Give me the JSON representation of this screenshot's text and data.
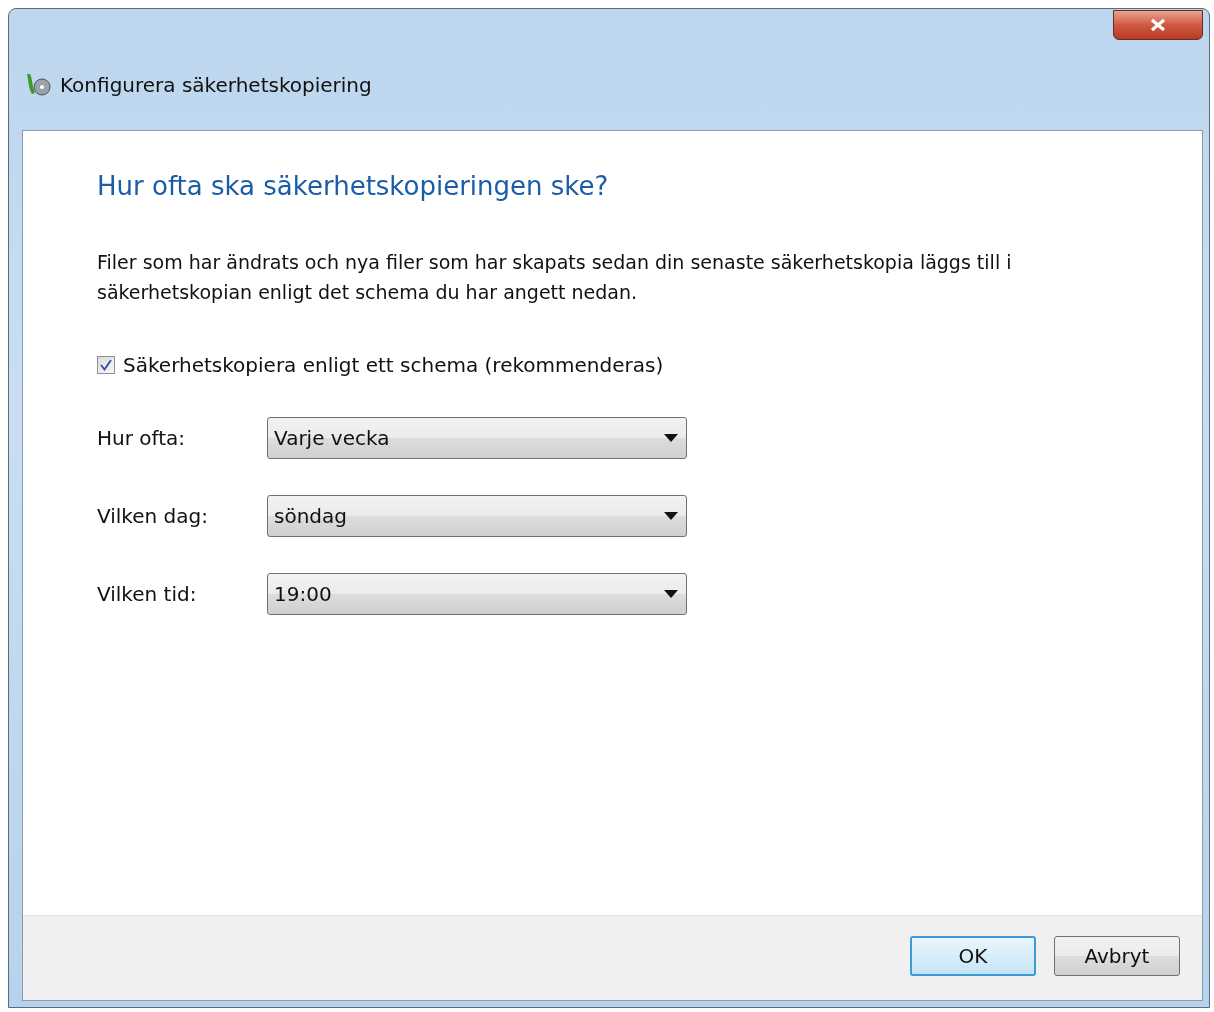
{
  "window": {
    "title": "Konfigurera säkerhetskopiering"
  },
  "heading": "Hur ofta ska säkerhetskopieringen ske?",
  "description": "Filer som har ändrats och nya filer som har skapats sedan din senaste säkerhetskopia läggs till i säkerhetskopian enligt det schema du har angett nedan.",
  "schedule_checkbox": {
    "label": "Säkerhetskopiera enligt ett schema (rekommenderas)",
    "checked": true
  },
  "fields": [
    {
      "label": "Hur ofta:",
      "value": "Varje vecka"
    },
    {
      "label": "Vilken dag:",
      "value": "söndag"
    },
    {
      "label": "Vilken tid:",
      "value": "19:00"
    }
  ],
  "buttons": [
    {
      "label": "OK",
      "default": true
    },
    {
      "label": "Avbryt",
      "default": false
    }
  ]
}
